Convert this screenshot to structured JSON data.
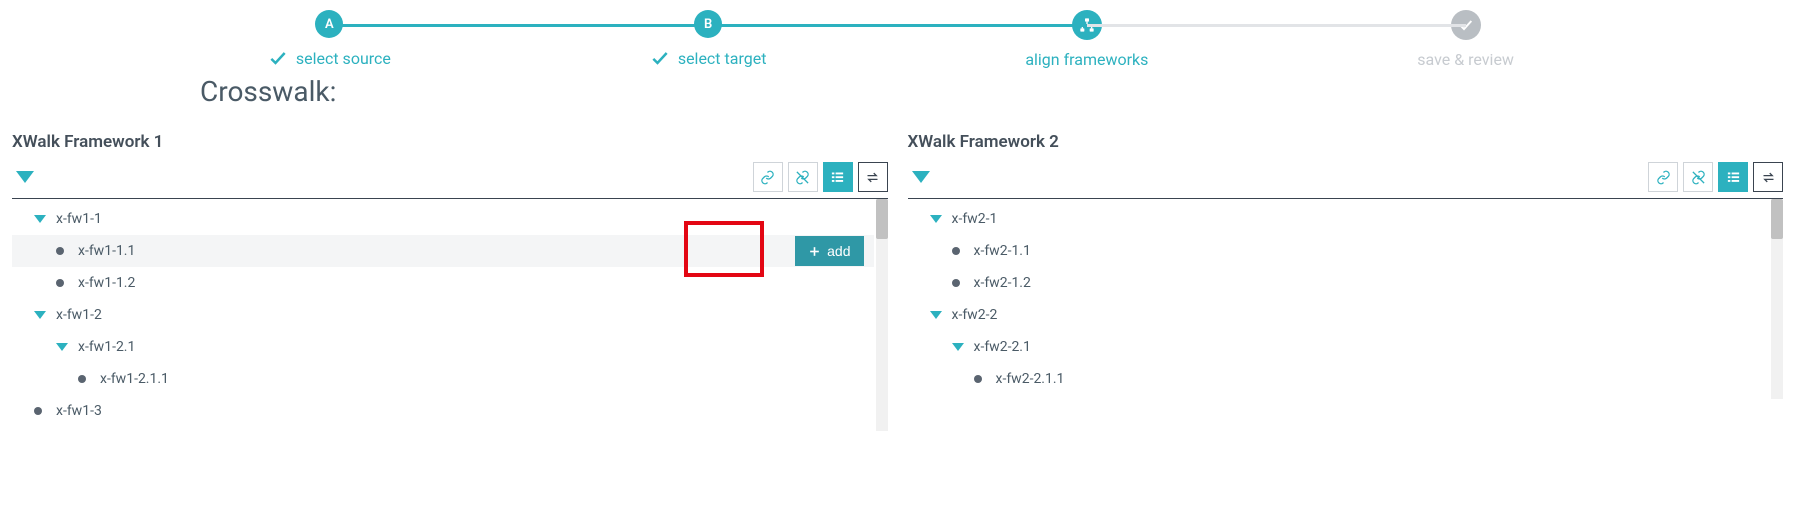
{
  "stepper": {
    "steps": [
      {
        "badge": "A",
        "label": "select source",
        "state": "done"
      },
      {
        "badge": "B",
        "label": "select target",
        "state": "done"
      },
      {
        "badge": "align",
        "label": "align frameworks",
        "state": "active"
      },
      {
        "badge": "check",
        "label": "save & review",
        "state": "future"
      }
    ]
  },
  "title": "Crosswalk:",
  "panels": {
    "left": {
      "header": "XWalk Framework 1",
      "toolbar": {
        "link": "link-icon",
        "unlink": "unlink-icon",
        "list": "list-icon",
        "swap": "swap-icon"
      },
      "tree": [
        {
          "indent": 0,
          "expander": true,
          "label": "x-fw1-1"
        },
        {
          "indent": 1,
          "expander": false,
          "label": "x-fw1-1.1",
          "hover": true,
          "add_label": "add"
        },
        {
          "indent": 1,
          "expander": false,
          "label": "x-fw1-1.2"
        },
        {
          "indent": 0,
          "expander": true,
          "label": "x-fw1-2"
        },
        {
          "indent": 1,
          "expander": true,
          "label": "x-fw1-2.1"
        },
        {
          "indent": 2,
          "expander": false,
          "label": "x-fw1-2.1.1"
        },
        {
          "indent": 0,
          "expander": false,
          "label": "x-fw1-3"
        }
      ]
    },
    "right": {
      "header": "XWalk Framework 2",
      "toolbar": {
        "link": "link-icon",
        "unlink": "unlink-icon",
        "list": "list-icon",
        "swap": "swap-icon"
      },
      "tree": [
        {
          "indent": 0,
          "expander": true,
          "label": "x-fw2-1"
        },
        {
          "indent": 1,
          "expander": false,
          "label": "x-fw2-1.1"
        },
        {
          "indent": 1,
          "expander": false,
          "label": "x-fw2-1.2"
        },
        {
          "indent": 0,
          "expander": true,
          "label": "x-fw2-2"
        },
        {
          "indent": 1,
          "expander": true,
          "label": "x-fw2-2.1"
        },
        {
          "indent": 2,
          "expander": false,
          "label": "x-fw2-2.1.1"
        }
      ]
    }
  },
  "colors": {
    "teal": "#2cb1bf",
    "gray": "#b9bec3",
    "highlight": "#e30613"
  }
}
